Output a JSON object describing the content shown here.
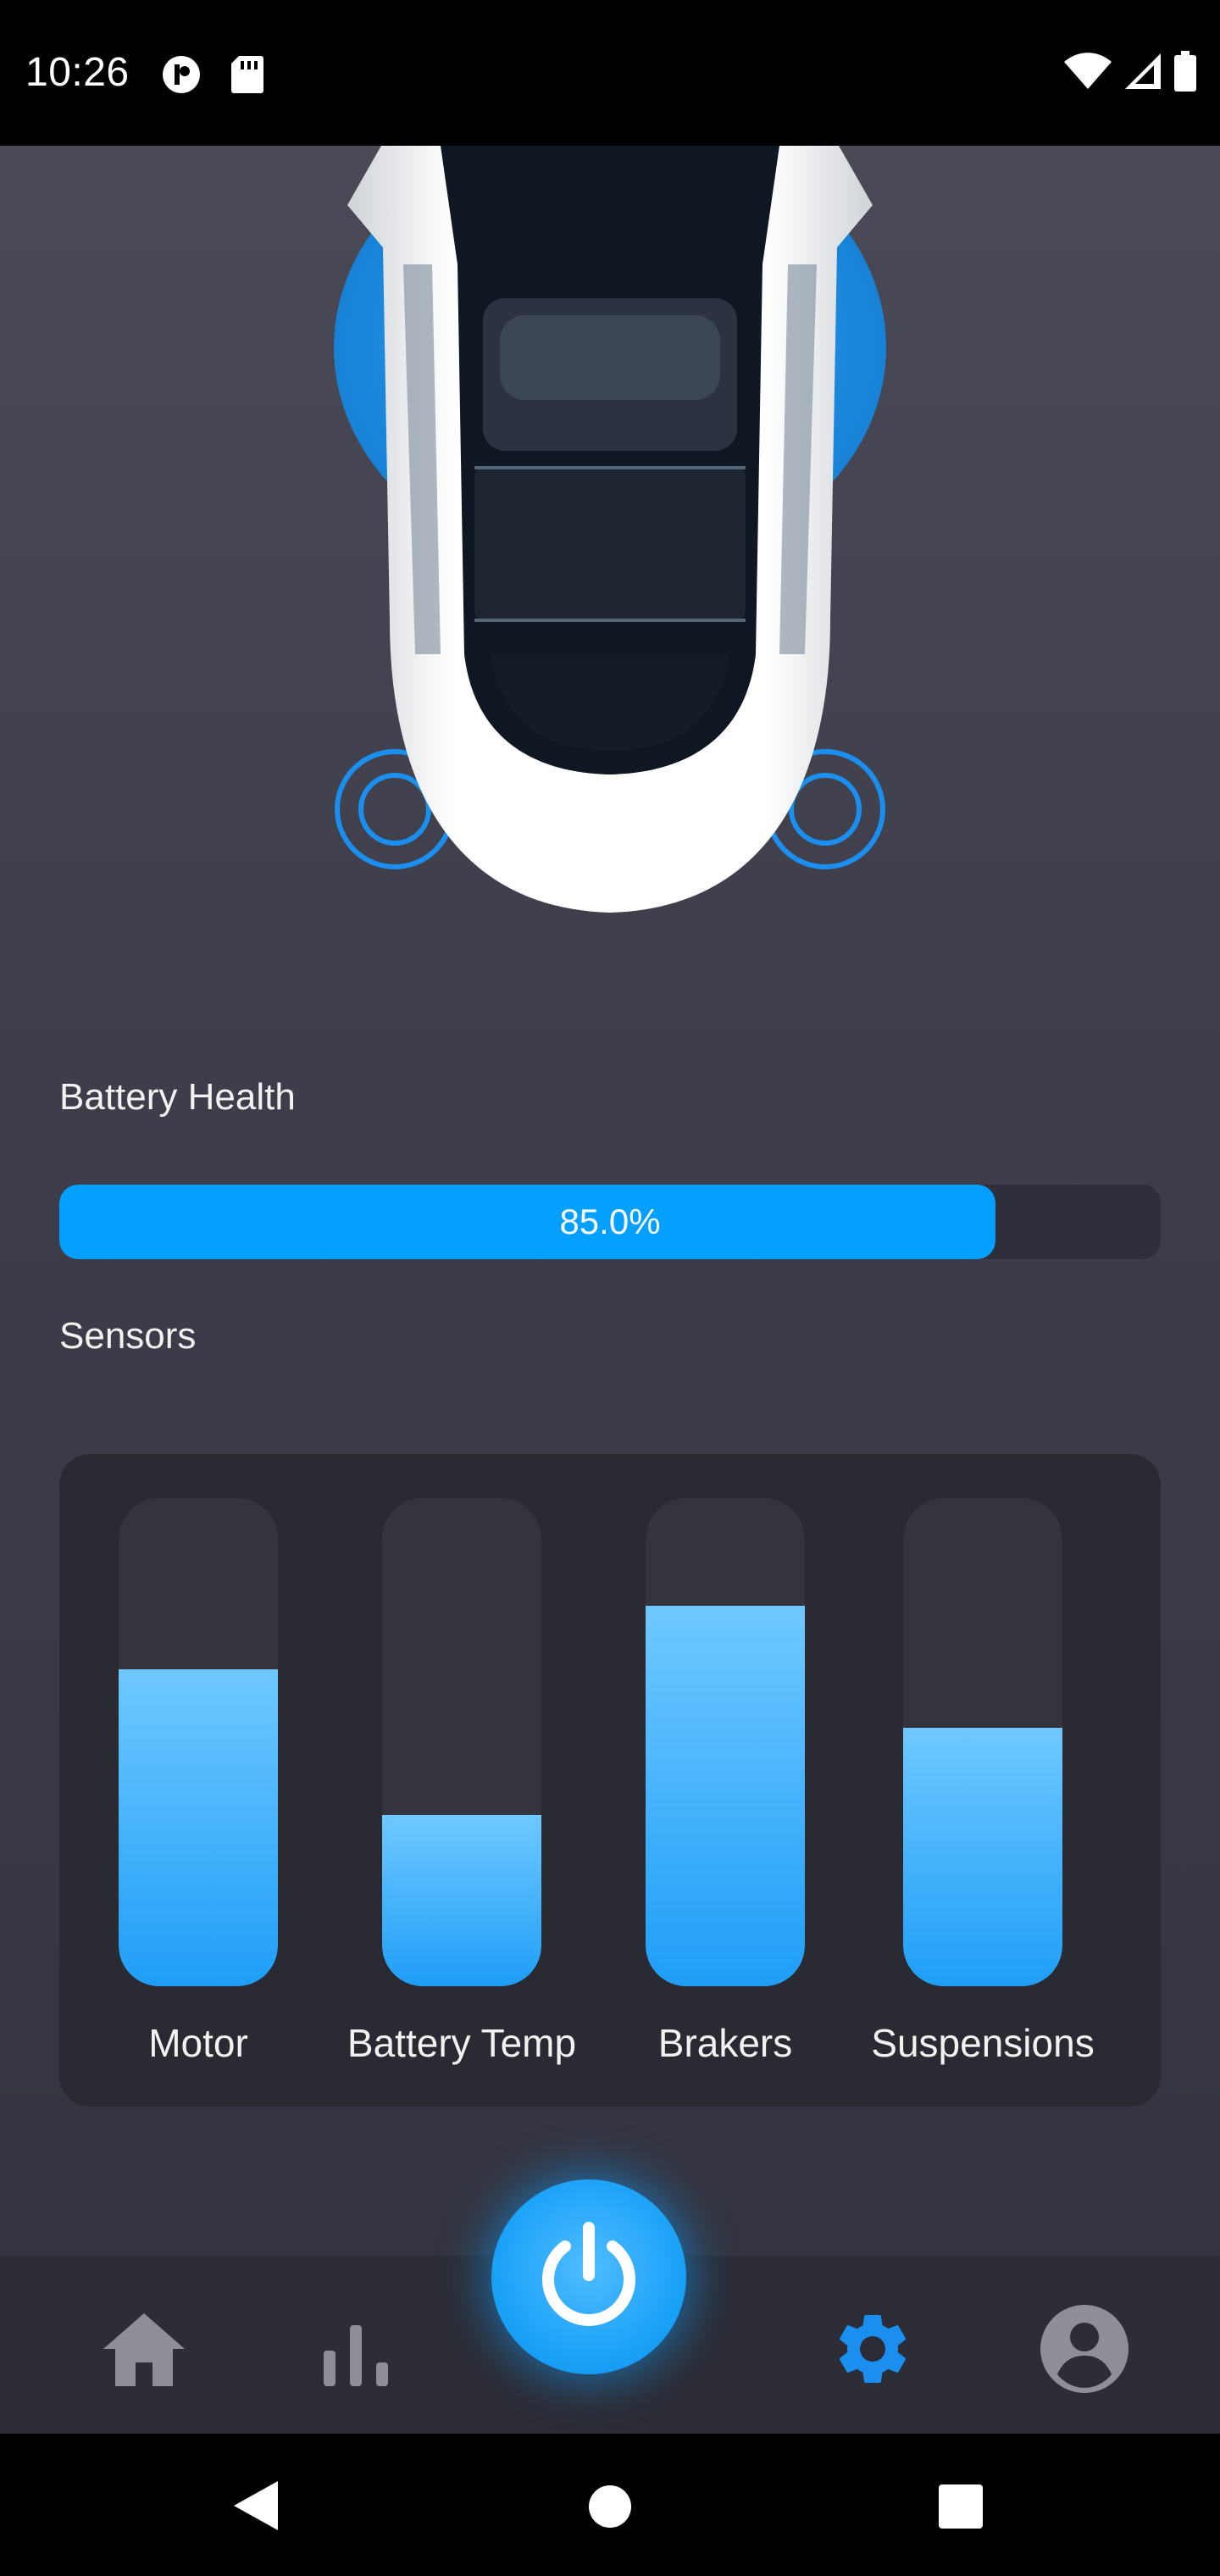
{
  "status_bar": {
    "time": "10:26",
    "left_icons": [
      "app-notification-icon",
      "sd-card-icon"
    ],
    "right_icons": [
      "wifi-icon",
      "cellular-signal-icon",
      "battery-icon"
    ]
  },
  "car": {
    "image": "car-top-view-image",
    "accent_color": "#1d9bf0"
  },
  "battery_health": {
    "label": "Battery Health",
    "value_text": "85.0%",
    "value": 0.85,
    "fill_color": "#03a0ff"
  },
  "sensors": {
    "label": "Sensors",
    "items": [
      {
        "label": "Motor",
        "level": 0.65
      },
      {
        "label": "Battery Temp",
        "level": 0.35
      },
      {
        "label": "Brakers",
        "level": 0.78
      },
      {
        "label": "Suspensions",
        "level": 0.53
      }
    ]
  },
  "bottom_nav": {
    "items": [
      {
        "icon": "home-icon",
        "active": false
      },
      {
        "icon": "stats-icon",
        "active": false
      },
      {
        "icon": "power-icon",
        "active": false
      },
      {
        "icon": "settings-icon",
        "active": true
      },
      {
        "icon": "account-icon",
        "active": false
      }
    ],
    "active_color": "#1a8ff0",
    "inactive_color": "#8e8e96"
  },
  "system_nav": {
    "icons": [
      "back-icon",
      "home-circle-icon",
      "recents-icon"
    ]
  }
}
